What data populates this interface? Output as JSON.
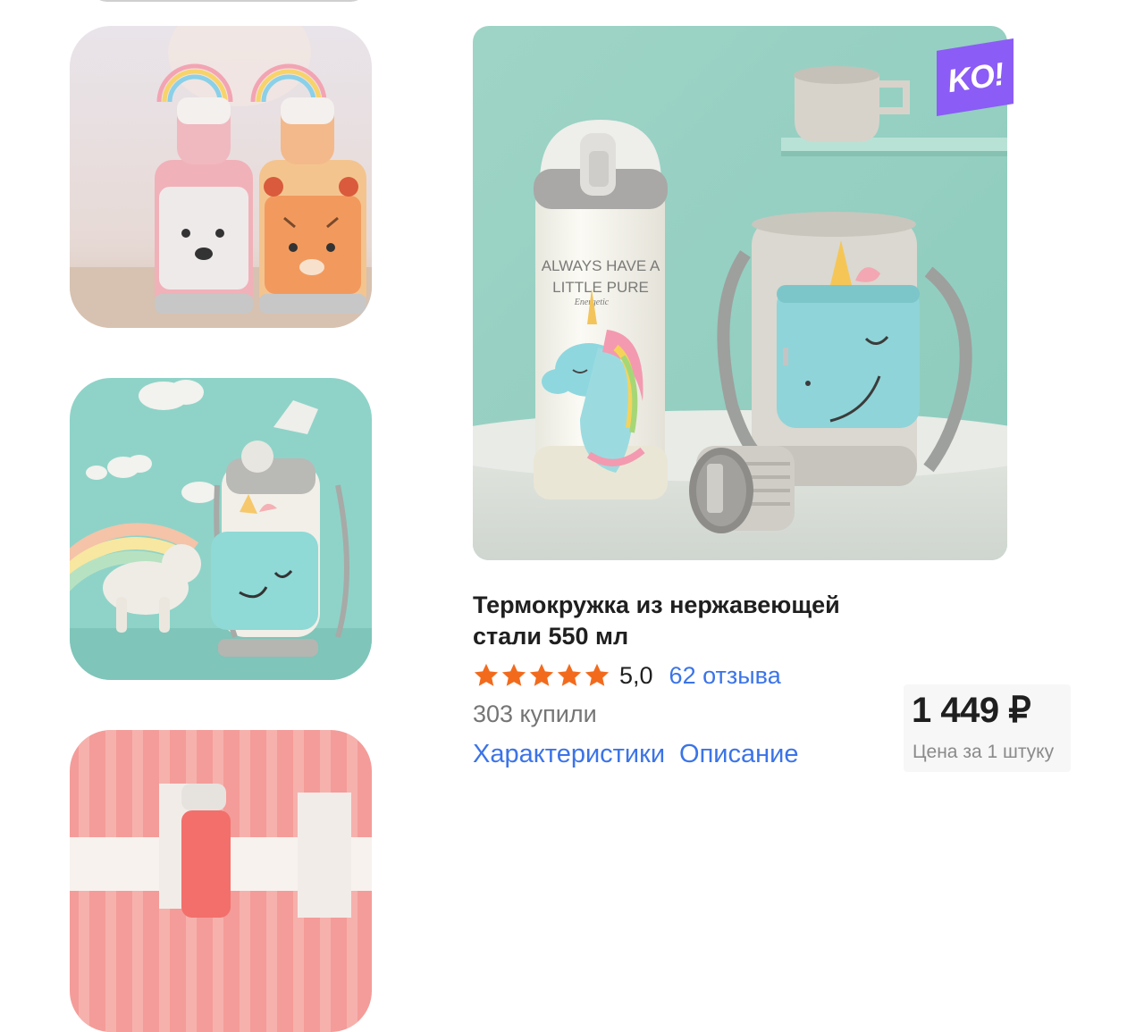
{
  "product": {
    "title": "Термокружка из нержавеющей стали 550 мл",
    "rating": "5,0",
    "stars": 5,
    "reviews": "62 отзыва",
    "bought": "303 купили",
    "badge": "KO!",
    "printed_text_line1": "ALWAYS HAVE A",
    "printed_text_line2": "LITTLE PURE",
    "printed_text_line3": "Energetic"
  },
  "tabs": {
    "characteristics": "Характеристики",
    "description": "Описание"
  },
  "price": {
    "amount": "1 449 ₽",
    "note": "Цена за 1 штуку"
  },
  "colors": {
    "accent_link": "#3b74e8",
    "star": "#f26b1d",
    "badge": "#8b5cf6"
  },
  "icons": [
    "star-icon"
  ]
}
